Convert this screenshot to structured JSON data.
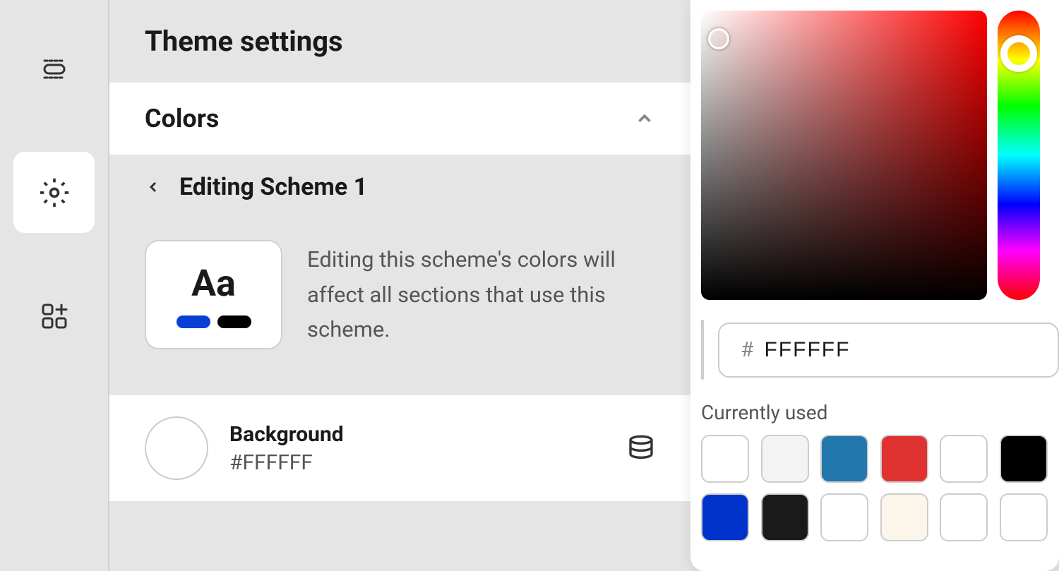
{
  "page_title": "Theme settings",
  "colors_section": {
    "title": "Colors"
  },
  "editing": {
    "title": "Editing Scheme 1",
    "preview_text": "Aa",
    "description": "Editing this scheme's colors will affect all sections that use this scheme."
  },
  "background": {
    "label": "Background",
    "value": "#FFFFFF",
    "color": "#FFFFFF"
  },
  "color_picker": {
    "hex_value": "FFFFFF",
    "hash": "#",
    "currently_used_label": "Currently used",
    "swatches": [
      "#FFFFFF",
      "#F3F3F3",
      "#2277AD",
      "#E03131",
      "#FFFFFF",
      "#000000",
      "#0033CC",
      "#1A1A1A",
      "#FFFFFF",
      "#FBF5EA",
      "#FFFFFF",
      "#FFFFFF"
    ]
  }
}
